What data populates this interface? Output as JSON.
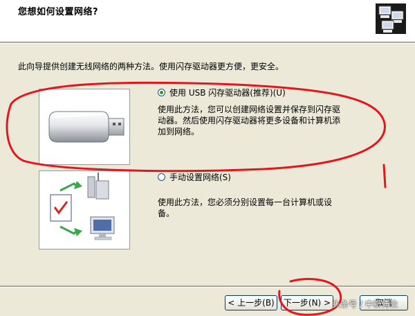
{
  "window": {
    "title": "您想如何设置网络?"
  },
  "header": {
    "icon": "network-computers-icon"
  },
  "intro": "此向导提供创建无线网络的两种方法。使用闪存驱动器更方便，更安全。",
  "options": [
    {
      "label": "使用 USB 闪存驱动器(推荐)(U)",
      "selected": true,
      "icon": "usb-flash-drive-icon",
      "description_lines": [
        "使用此方法，您可以创建网络设置并保存到闪存驱",
        "动器。然后使用闪存驱动器将更多设备和计算机添",
        "加到网络。"
      ]
    },
    {
      "label": "手动设置网络(S)",
      "selected": false,
      "icon": "manual-network-icon",
      "description_lines": [
        "使用此方法，您必须分别设置每一台计算机或设",
        "备。"
      ]
    }
  ],
  "buttons": {
    "back": "< 上一步(B)",
    "next": "下一步(N) >",
    "cancel": "取消"
  },
  "watermark": "头条号 / 中新傅业",
  "annotation_color": "#e8141b"
}
